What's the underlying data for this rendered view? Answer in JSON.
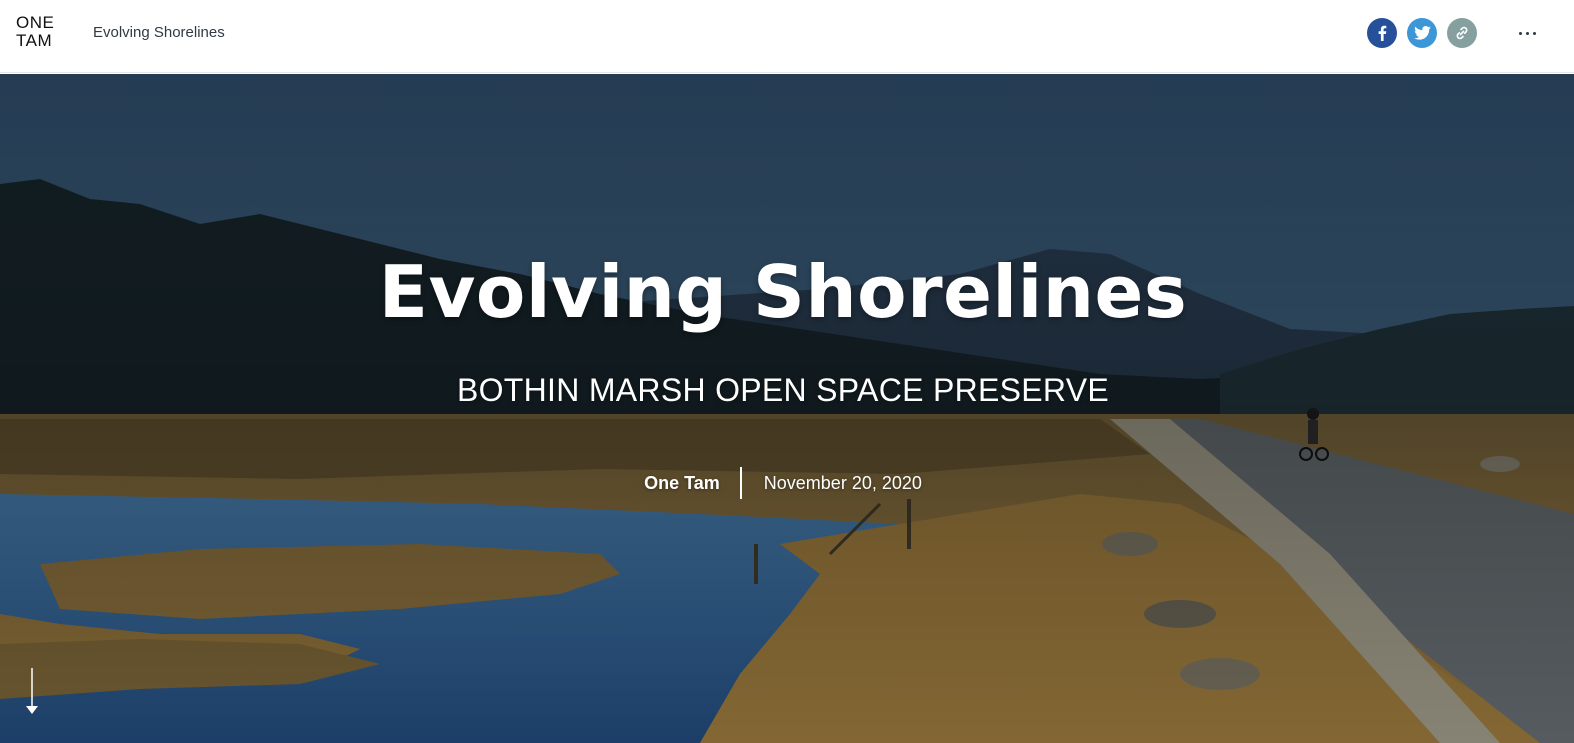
{
  "header": {
    "logo_line1": "ONE",
    "logo_line2": "TAM",
    "story_title": "Evolving Shorelines",
    "share": {
      "facebook": "facebook-icon",
      "twitter": "twitter-icon",
      "link": "link-icon"
    },
    "more_menu": "more-icon"
  },
  "hero": {
    "title": "Evolving Shorelines",
    "subtitle": "BOTHIN MARSH OPEN SPACE PRESERVE",
    "author": "One Tam",
    "date": "November 20, 2020",
    "scroll_cue_icon": "arrow-down-icon"
  },
  "colors": {
    "facebook": "#27509b",
    "twitter": "#3d97d6",
    "link": "#86a0a0",
    "header_text": "#2e3b45"
  }
}
